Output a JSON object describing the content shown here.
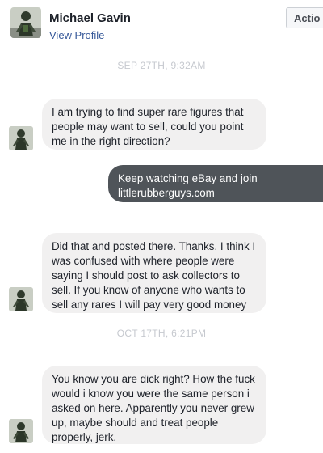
{
  "header": {
    "name": "Michael Gavin",
    "view_profile": "View Profile",
    "actions_label": "Actio"
  },
  "conversation": {
    "timestamps": [
      "SEP 27TH, 9:32AM",
      "OCT 17TH, 6:21PM"
    ],
    "messages": [
      {
        "direction": "incoming",
        "text": "I am trying to find super rare figures that people may want to sell, could you point me in the right direction?"
      },
      {
        "direction": "outgoing",
        "text": "Keep watching eBay and join littlerubberguys.com"
      },
      {
        "direction": "incoming",
        "text": "Did that and posted there. Thanks. I think I was confused with where people were saying I should post to ask collectors to sell. If you know of anyone who wants to sell any rares I will pay very good money"
      },
      {
        "direction": "incoming",
        "text": "You know you are dick right? How the fuck would i know you were the same person i asked on here. Apparently you never grew up, maybe should and treat people properly, jerk."
      }
    ]
  },
  "colors": {
    "incoming_bubble": "#f1f0f0",
    "outgoing_bubble": "#4f5459",
    "link": "#365899"
  }
}
